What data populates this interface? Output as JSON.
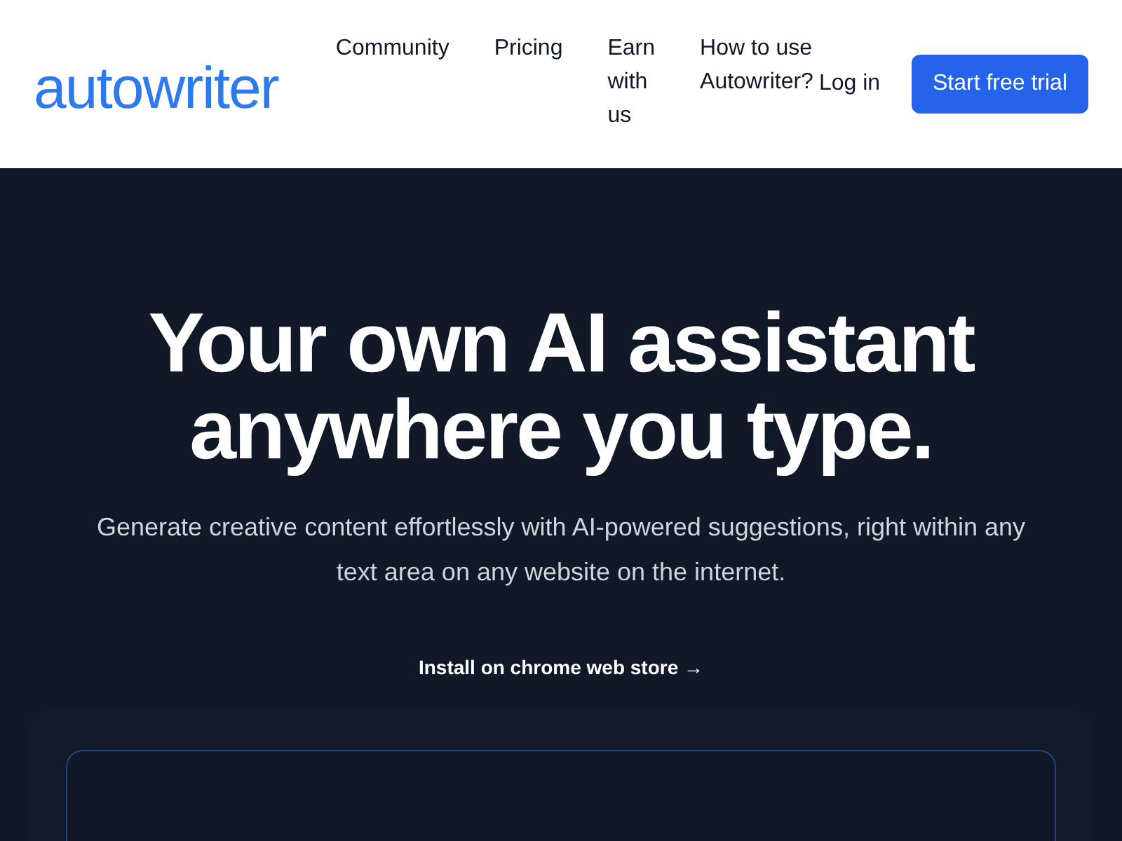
{
  "header": {
    "logo": "autowriter",
    "nav": [
      {
        "label": "Community"
      },
      {
        "label": "Pricing"
      },
      {
        "label": "Earn with us"
      },
      {
        "label": "How to use Autowriter?"
      }
    ],
    "login": "Log in",
    "cta": "Start free trial"
  },
  "hero": {
    "title": "Your own AI assistant anywhere you type.",
    "subtitle": "Generate creative content effortlessly with AI-powered suggestions, right within any text area on any website on the internet.",
    "install_link": "Install on chrome web store →"
  }
}
